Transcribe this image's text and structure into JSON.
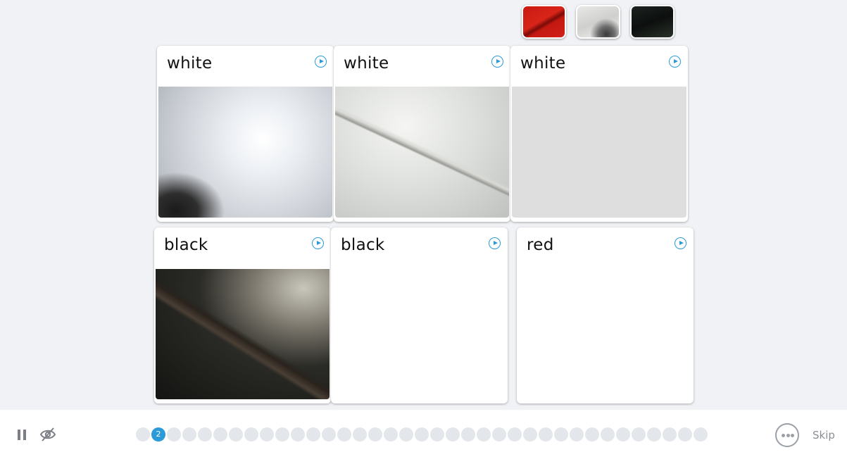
{
  "thumbnails": [
    {
      "name": "red-fabric-thumb",
      "color": "red"
    },
    {
      "name": "white-feather-thumb",
      "color": "white"
    },
    {
      "name": "black-fabric-thumb",
      "color": "black"
    }
  ],
  "cards": [
    {
      "label": "white"
    },
    {
      "label": "white"
    },
    {
      "label": "white"
    },
    {
      "label": "black"
    },
    {
      "label": "black"
    },
    {
      "label": "red"
    }
  ],
  "progress": {
    "current_label": "2",
    "total_dots": 37,
    "current_index": 1
  },
  "footer": {
    "skip_label": "Skip"
  },
  "colors": {
    "accent": "#2a9ad8",
    "background": "#f0f2f5"
  }
}
